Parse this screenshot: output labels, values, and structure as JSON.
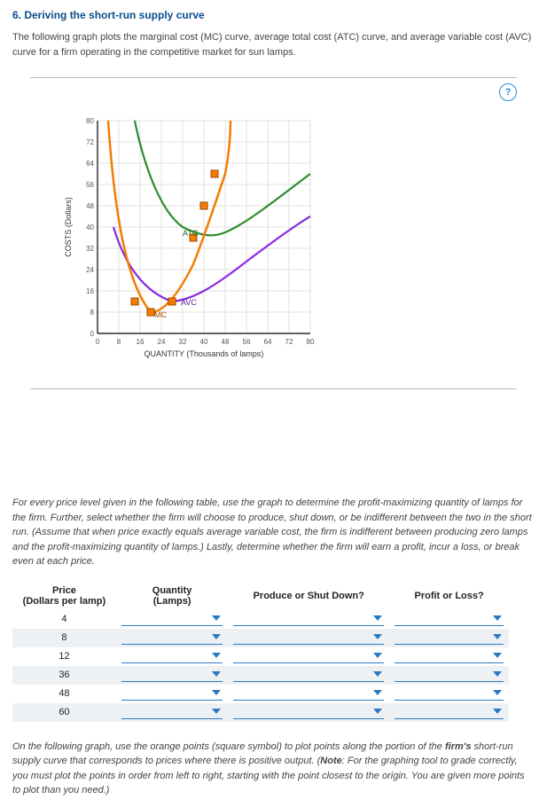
{
  "question": {
    "number_title": "6. Deriving the short-run supply curve",
    "intro": "The following graph plots the marginal cost (MC) curve, average total cost (ATC) curve, and average variable cost (AVC) curve for a firm operating in the competitive market for sun lamps."
  },
  "help_icon": "?",
  "chart_data": {
    "type": "line",
    "xlabel": "QUANTITY (Thousands of lamps)",
    "ylabel": "COSTS (Dollars)",
    "xlim": [
      0,
      80
    ],
    "ylim": [
      0,
      80
    ],
    "x_ticks": [
      0,
      8,
      16,
      24,
      32,
      40,
      48,
      56,
      64,
      72,
      80
    ],
    "y_ticks": [
      0,
      8,
      16,
      24,
      32,
      40,
      48,
      56,
      64,
      72,
      80
    ],
    "series": [
      {
        "name": "MC",
        "color": "#f57c00",
        "x": [
          4,
          8,
          14,
          20,
          26,
          32,
          36,
          40,
          44,
          48,
          50
        ],
        "y": [
          80,
          30,
          12,
          8,
          12,
          18,
          26,
          36,
          48,
          60,
          80
        ]
      },
      {
        "name": "ATC",
        "color": "#2e8b2e",
        "x": [
          14,
          18,
          24,
          32,
          40,
          48,
          56,
          64,
          72,
          80
        ],
        "y": [
          80,
          60,
          48,
          40,
          36,
          38,
          42,
          48,
          54,
          60
        ]
      },
      {
        "name": "AVC",
        "color": "#8a2be2",
        "x": [
          6,
          12,
          20,
          28,
          36,
          44,
          52,
          60,
          70,
          80
        ],
        "y": [
          40,
          24,
          16,
          12,
          14,
          18,
          24,
          30,
          38,
          44
        ]
      }
    ],
    "markers": [
      {
        "x": 14,
        "y": 12,
        "label": ""
      },
      {
        "x": 20,
        "y": 8,
        "label": "MC"
      },
      {
        "x": 28,
        "y": 12,
        "label": "AVC"
      },
      {
        "x": 36,
        "y": 36,
        "label": "ATC"
      },
      {
        "x": 40,
        "y": 48,
        "label": ""
      },
      {
        "x": 44,
        "y": 60,
        "label": ""
      }
    ],
    "curve_labels": {
      "MC": "MC",
      "ATC": "ATC",
      "AVC": "AVC"
    }
  },
  "prompt": "For every price level given in the following table, use the graph to determine the profit-maximizing quantity of lamps for the firm. Further, select whether the firm will choose to produce, shut down, or be indifferent between the two in the short run. (Assume that when price exactly equals average variable cost, the firm is indifferent between producing zero lamps and the profit-maximizing quantity of lamps.) Lastly, determine whether the firm will earn a profit, incur a loss, or break even at each price.",
  "table": {
    "headers": {
      "price_line1": "Price",
      "price_line2": "(Dollars per lamp)",
      "qty_line1": "Quantity",
      "qty_line2": "(Lamps)",
      "produce": "Produce or Shut Down?",
      "profit": "Profit or Loss?"
    },
    "prices": [
      "4",
      "8",
      "12",
      "36",
      "48",
      "60"
    ]
  },
  "note": {
    "pre": "On the following graph, use the orange points (square symbol) to plot points along the portion of the ",
    "bold1": "firm's",
    "mid1": " short-run supply curve that corresponds to prices where there is positive output. (",
    "bold2": "Note",
    "mid2": ": For the graphing tool to grade correctly, you must plot the points in order from left to right, starting with the point closest to the origin. You are given more points to plot than you need.)"
  }
}
